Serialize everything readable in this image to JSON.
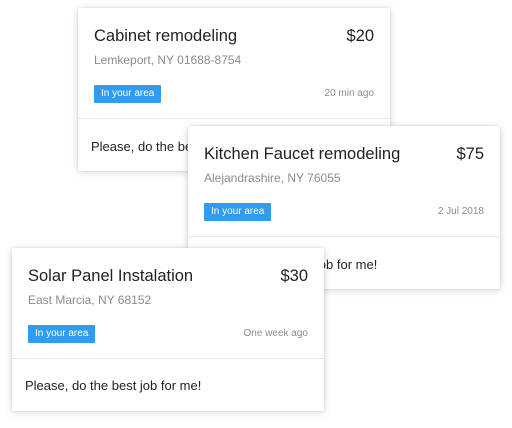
{
  "colors": {
    "badge_background": "#2d9cf2",
    "badge_text": "#ffffff",
    "title_text": "#222222",
    "secondary_text": "#8b8b8b",
    "card_background": "#ffffff"
  },
  "cards": [
    {
      "title": "Cabinet remodeling",
      "price": "$20",
      "location": "Lemkeport, NY 01688-8754",
      "badge": "In your area",
      "time": "20 min ago",
      "message": "Please, do the best job for me!"
    },
    {
      "title": "Kitchen Faucet remodeling",
      "price": "$75",
      "location": "Alejandrashire, NY 76055",
      "badge": "In your area",
      "time": "2 Jul 2018",
      "message": "Please, do the best job for me!"
    },
    {
      "title": "Solar Panel Instalation",
      "price": "$30",
      "location": "East Marcia, NY 68152",
      "badge": "In your area",
      "time": "One week ago",
      "message": "Please, do the best job for me!"
    }
  ]
}
